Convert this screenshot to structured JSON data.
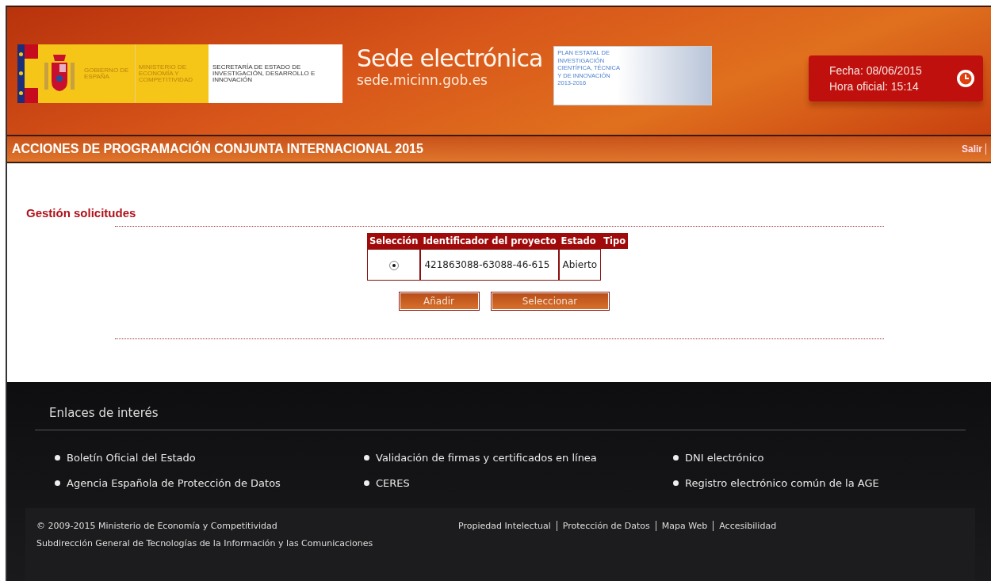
{
  "header": {
    "gov_logo": {
      "gobierno": "GOBIERNO DE ESPAÑA",
      "ministerio": "MINISTERIO DE ECONOMÍA Y COMPETITIVIDAD",
      "secretaria": "SECRETARÍA DE ESTADO DE INVESTIGACIÓN, DESARROLLO E INNOVACIÓN"
    },
    "site_title": "Sede electrónica",
    "site_url": "sede.micinn.gob.es",
    "plan_banner": "PLAN ESTATAL DE INVESTIGACIÓN CIENTÍFICA, TÉCNICA Y DE INNOVACIÓN 2013-2016",
    "date": "Fecha: 08/06/2015",
    "time": "Hora oficial: 15:14"
  },
  "title_bar": {
    "title": "ACCIONES DE PROGRAMACIÓN CONJUNTA INTERNACIONAL 2015",
    "logout": "Salir"
  },
  "section_title": "Gestión solicitudes",
  "table": {
    "columns": [
      "Selección",
      "Identificador del proyecto",
      "Estado",
      "Tipo"
    ],
    "rows": [
      {
        "selected": true,
        "id": "421863088-63088-46-615",
        "estado": "Abierto"
      }
    ]
  },
  "buttons": [
    "Añadir",
    "Seleccionar"
  ],
  "footer": {
    "links_title": "Enlaces de interés",
    "links": [
      "Boletín Oficial del Estado",
      "Validación de firmas y certificados en línea",
      "DNI electrónico",
      "Agencia Española de Protección de Datos",
      "CERES",
      "Registro electrónico común de la AGE"
    ],
    "copyright": "© 2009-2015 Ministerio de Economía y Competitividad",
    "department": "Subdirección General de Tecnologías de la Información y las Comunicaciones",
    "legal_links": [
      "Propiedad Intelectual",
      "Protección de Datos",
      "Mapa Web",
      "Accesibilidad"
    ]
  }
}
